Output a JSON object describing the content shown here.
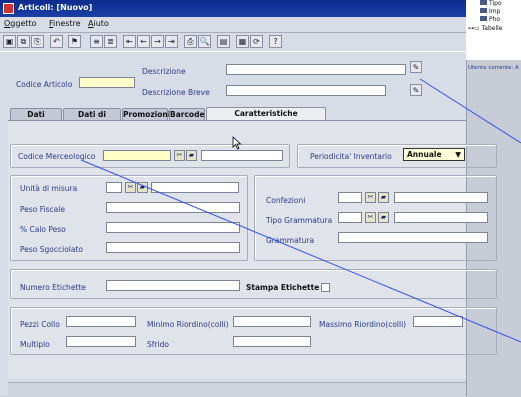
{
  "window": {
    "title": "Articoli: [Nuovo]"
  },
  "menu": [
    "Oggetto",
    "Finestre",
    "Aiuto"
  ],
  "toolbar": [
    {
      "name": "save-icon",
      "glyph": "▣"
    },
    {
      "name": "copy-icon",
      "glyph": "⧉"
    },
    {
      "name": "paste-icon",
      "glyph": "⎘"
    },
    {
      "name": "undo-icon",
      "glyph": "↶"
    },
    {
      "name": "filter-icon",
      "glyph": "⚑"
    },
    {
      "name": "sort-icon",
      "glyph": "≡"
    },
    {
      "name": "sort-desc-icon",
      "glyph": "≣"
    },
    {
      "name": "first-icon",
      "glyph": "⇤"
    },
    {
      "name": "prev-icon",
      "glyph": "←"
    },
    {
      "name": "next-icon",
      "glyph": "→"
    },
    {
      "name": "last-icon",
      "glyph": "⇥"
    },
    {
      "name": "print-icon",
      "glyph": "⎙"
    },
    {
      "name": "preview-icon",
      "glyph": "🔍"
    },
    {
      "name": "export-icon",
      "glyph": "▤"
    },
    {
      "name": "calc-icon",
      "glyph": "▦"
    },
    {
      "name": "refresh-icon",
      "glyph": "⟳"
    },
    {
      "name": "help-icon",
      "glyph": "?"
    }
  ],
  "tree": {
    "items": [
      "Tipo",
      "Imp",
      "Pho",
      "Tabelle"
    ],
    "user_label": "Utente corrente: A"
  },
  "header": {
    "codice_articolo": "Codice Articolo",
    "descrizione": "Descrizione",
    "descrizione_breve": "Descrizione Breve"
  },
  "tabs": [
    "Dati Primari",
    "Dati di vendita",
    "Promozioni",
    "Barcode",
    "Caratteristiche merceologiche"
  ],
  "active_tab": 4,
  "content": {
    "codice_merceologico": "Codice Merceologico",
    "periodicita": "Periodicita' Inventario",
    "periodicita_value": "Annuale",
    "unita_misura": "Unità di misura",
    "peso_fiscale": "Peso Fiscale",
    "calo_peso": "% Calo Peso",
    "peso_sgocciolato": "Peso Sgocciolato",
    "confezioni": "Confezioni",
    "tipo_grammatura": "Tipo Grammatura",
    "grammatura": "Grammatura",
    "numero_etichette": "Numero Etichette",
    "stampa_etichette": "Stampa Etichette",
    "pezzi_collo": "Pezzi Collo",
    "minimo_riordino": "Minimo Riordino(colli)",
    "massimo_riordino": "Massimo Riordino(colli)",
    "multiplo": "Multiplo",
    "sfrido": "Sfrido"
  }
}
